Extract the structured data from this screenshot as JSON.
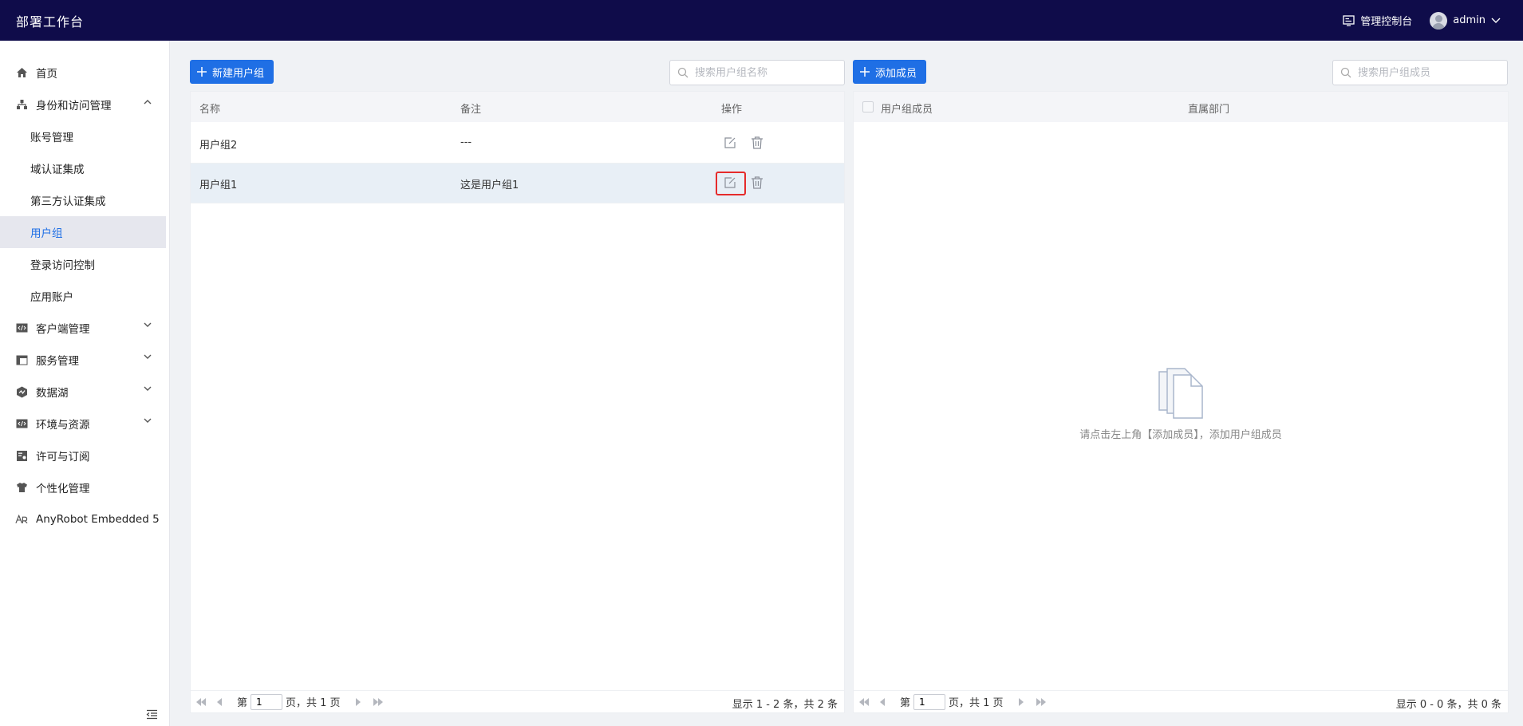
{
  "header": {
    "app_title": "部署工作台",
    "console_label": "管理控制台",
    "user_name": "admin"
  },
  "sidebar": {
    "items": [
      {
        "label": "首页",
        "icon": "home-icon"
      },
      {
        "label": "身份和访问管理",
        "icon": "org-icon",
        "expanded": true
      },
      {
        "label": "账号管理"
      },
      {
        "label": "域认证集成"
      },
      {
        "label": "第三方认证集成"
      },
      {
        "label": "用户组",
        "active": true
      },
      {
        "label": "登录访问控制"
      },
      {
        "label": "应用账户"
      },
      {
        "label": "客户端管理",
        "icon": "code-icon"
      },
      {
        "label": "服务管理",
        "icon": "layout-icon"
      },
      {
        "label": "数据湖",
        "icon": "datalake-icon"
      },
      {
        "label": "环境与资源",
        "icon": "code-icon"
      },
      {
        "label": "许可与订阅",
        "icon": "license-icon"
      },
      {
        "label": "个性化管理",
        "icon": "shirt-icon"
      },
      {
        "label": "AnyRobot Embedded 5",
        "icon": "anyrobot-icon"
      }
    ]
  },
  "left": {
    "new_button_label": "新建用户组",
    "search_placeholder": "搜索用户组名称",
    "columns": [
      "名称",
      "备注",
      "操作"
    ],
    "rows": [
      {
        "name": "用户组2",
        "note": "---"
      },
      {
        "name": "用户组1",
        "note": "这是用户组1"
      }
    ],
    "pager": {
      "prefix": "第",
      "page": "1",
      "suffix": "页，共 1 页",
      "summary": "显示 1 - 2 条，共 2 条"
    }
  },
  "right": {
    "add_button_label": "添加成员",
    "search_placeholder": "搜索用户组成员",
    "columns": [
      "用户组成员",
      "直属部门"
    ],
    "empty_text": "请点击左上角【添加成员】，添加用户组成员",
    "pager": {
      "prefix": "第",
      "page": "1",
      "suffix": "页，共 1 页",
      "summary": "显示 0 - 0 条，共 0 条"
    }
  },
  "colors": {
    "header_bg": "#0f0c4a",
    "accent": "#1f6fe5",
    "highlight": "#e52b2b"
  }
}
